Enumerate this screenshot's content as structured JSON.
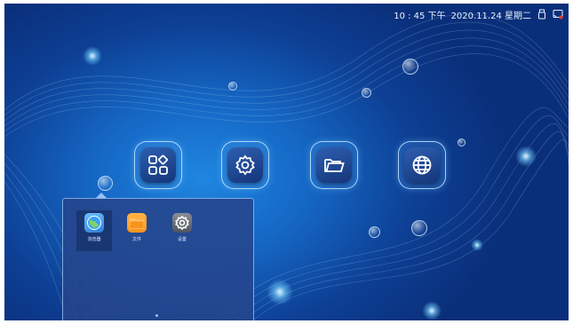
{
  "status_bar": {
    "clock": "10 : 45 下午",
    "date": "2020.11.24 星期二",
    "icons": [
      "usb-icon",
      "screen-cast-icon"
    ]
  },
  "home_tiles": [
    {
      "name": "apps-tile",
      "icon": "grid-apps-icon"
    },
    {
      "name": "settings-tile",
      "icon": "gear-icon"
    },
    {
      "name": "files-tile",
      "icon": "folder-icon"
    },
    {
      "name": "browser-tile",
      "icon": "globe-icon"
    }
  ],
  "app_drawer": {
    "apps": [
      {
        "label": "浏览器",
        "icon": "browser-globe-icon",
        "selected": true
      },
      {
        "label": "文件",
        "icon": "folder-icon",
        "selected": false
      },
      {
        "label": "设置",
        "icon": "settings-gear-icon",
        "selected": false
      }
    ]
  },
  "colors": {
    "background": "#1567c4",
    "drawer": "#26468c",
    "folder_orange": "#f7941d"
  }
}
